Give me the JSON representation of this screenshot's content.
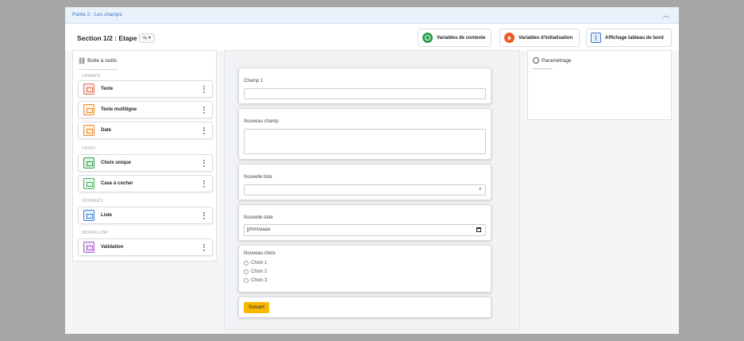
{
  "breadcrumb": "Partie 2 : Les champs",
  "header": {
    "title": "Section 1/2 : Etape 1",
    "mode_label": "⇆ ▾",
    "buttons": [
      {
        "label": "Variables de contexte",
        "icon": "globe-icon"
      },
      {
        "label": "Variables d'initialisation",
        "icon": "play-icon"
      },
      {
        "label": "Affichage tableau de bord",
        "icon": "dashboard-icon"
      }
    ]
  },
  "toolbox": {
    "title": "Boite à outils",
    "groups": [
      {
        "label": "CHAMPS",
        "items": [
          {
            "label": "Texte"
          },
          {
            "label": "Texte multiligne"
          },
          {
            "label": "Date"
          }
        ]
      },
      {
        "label": "CHOIX",
        "items": [
          {
            "label": "Choix unique"
          },
          {
            "label": "Case à cocher"
          }
        ]
      },
      {
        "label": "DONNÉES",
        "items": [
          {
            "label": "Liste"
          }
        ]
      },
      {
        "label": "WORKFLOW",
        "items": [
          {
            "label": "Validation"
          }
        ]
      }
    ]
  },
  "form": {
    "fields": [
      {
        "label": "Champ 1",
        "value": ""
      },
      {
        "label": "Nouveau champ",
        "value": ""
      },
      {
        "label": "Nouvelle liste",
        "value": ""
      },
      {
        "label": "Nouvelle date",
        "placeholder": "jj/mm/aaaa"
      }
    ],
    "choice": {
      "label": "Nouveau choix",
      "options": [
        "Choix 1",
        "Choix 2",
        "Choix 3"
      ]
    },
    "submit_label": "Suivant"
  },
  "settings": {
    "title": "Paramétrage"
  },
  "colors": {
    "accent": "#fbb800",
    "link": "#3a77c6"
  }
}
